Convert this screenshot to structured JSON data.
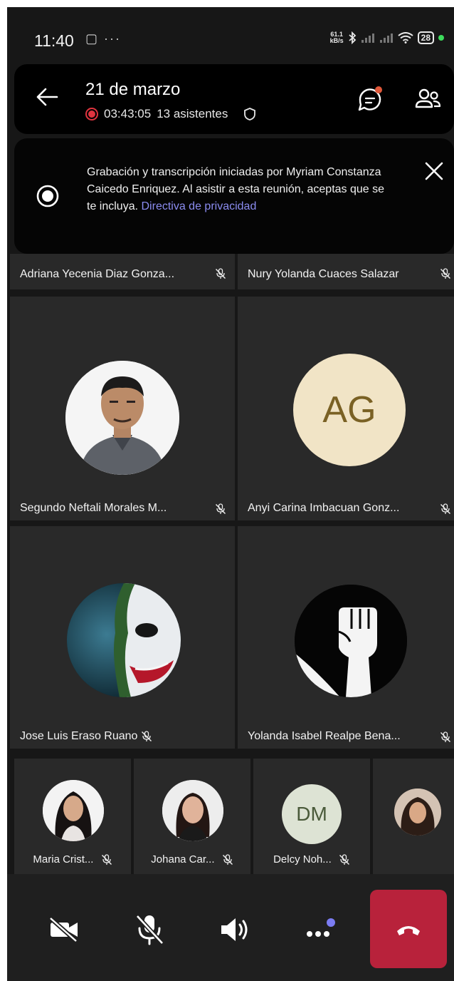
{
  "status_bar": {
    "time": "11:40",
    "left_icons": "▢ ···",
    "net_speed_top": "61.1",
    "net_speed_bottom": "kB/s",
    "battery": "28"
  },
  "header": {
    "title": "21 de marzo",
    "duration": "03:43:05",
    "attendees": "13 asistentes"
  },
  "recording_banner": {
    "text": "Grabación y transcripción iniciadas por Myriam Constanza Caicedo Enriquez. Al asistir a esta reunión, aceptas que se te incluya.",
    "link": "Directiva de privacidad"
  },
  "participants": [
    {
      "name": "Adriana Yecenia Diaz Gonza...",
      "muted": true
    },
    {
      "name": "Nury Yolanda Cuaces Salazar",
      "muted": true
    },
    {
      "name": "Segundo Neftali Morales M...",
      "muted": true,
      "avatar": "photo"
    },
    {
      "name": "Anyi Carina Imbacuan Gonz...",
      "muted": true,
      "initials": "AG"
    },
    {
      "name": "Jose Luis Eraso Ruano",
      "muted": true,
      "avatar": "photo"
    },
    {
      "name": "Yolanda Isabel Realpe Bena...",
      "muted": true,
      "avatar": "fist"
    }
  ],
  "small_participants": [
    {
      "name": "Maria Crist...",
      "muted": true,
      "avatar": "photo"
    },
    {
      "name": "Johana Car...",
      "muted": true,
      "avatar": "photo"
    },
    {
      "name": "Delcy Noh...",
      "muted": true,
      "initials": "DM"
    },
    {
      "name": "",
      "avatar": "photo"
    }
  ],
  "colors": {
    "background": "#171717",
    "tile": "#292929",
    "hangup": "#b8223b",
    "link": "#8b8cf0",
    "recording": "#e0343f",
    "ag_avatar_bg": "#f1e4c6",
    "ag_avatar_text": "#7a6124",
    "dm_avatar_bg": "#dde3d4",
    "dm_avatar_text": "#4a5a3a"
  },
  "icons": {
    "back": "arrow-left-icon",
    "chat": "chat-icon",
    "people": "people-icon",
    "close": "close-icon",
    "camera_off": "camera-off-icon",
    "mic_off": "mic-off-icon",
    "speaker": "speaker-icon",
    "more": "more-icon",
    "hangup": "phone-hangup-icon"
  }
}
